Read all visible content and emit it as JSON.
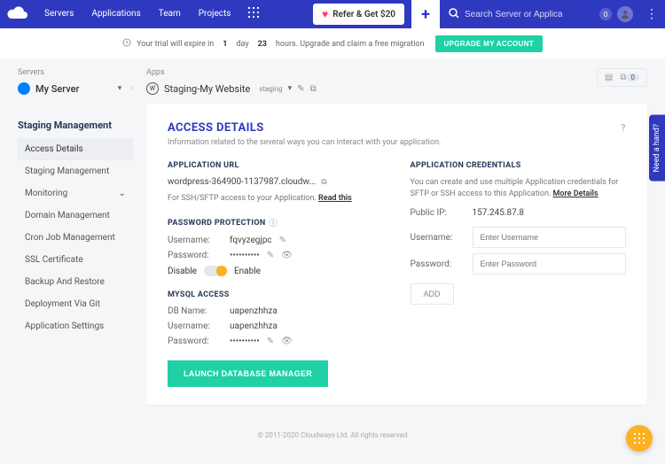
{
  "nav": {
    "servers": "Servers",
    "applications": "Applications",
    "team": "Team",
    "projects": "Projects"
  },
  "top": {
    "refer": "Refer & Get $20",
    "search_placeholder": "Search Server or Application",
    "notif_count": "0"
  },
  "trial": {
    "prefix": "Your trial will expire in",
    "days": "1",
    "days_label": "day",
    "hours": "23",
    "hours_label": "hours. Upgrade and claim a free migration",
    "upgrade": "UPGRADE MY ACCOUNT"
  },
  "breadcrumb": {
    "servers_label": "Servers",
    "server_name": "My Server",
    "apps_label": "Apps",
    "app_name": "Staging-My Website",
    "app_tag": "staging"
  },
  "app_status_count": "0",
  "side": {
    "heading": "Staging Management",
    "items": [
      "Access Details",
      "Staging Management",
      "Monitoring",
      "Domain Management",
      "Cron Job Management",
      "SSL Certificate",
      "Backup And Restore",
      "Deployment Via Git",
      "Application Settings"
    ]
  },
  "card": {
    "title": "ACCESS DETAILS",
    "subtitle": "Information related to the several ways you can interact with your application."
  },
  "left": {
    "app_url_head": "APPLICATION URL",
    "app_url": "wordpress-364900-1137987.cloudw...",
    "app_url_hint_pre": "For SSH/SFTP access to your Application. ",
    "app_url_hint_link": "Read this",
    "pwd_head": "PASSWORD PROTECTION",
    "user_label": "Username:",
    "user_val": "fqvyzegjpc",
    "pass_label": "Password:",
    "pass_val": "••••••••••",
    "disable": "Disable",
    "enable": "Enable",
    "mysql_head": "MYSQL ACCESS",
    "db_label": "DB Name:",
    "db_val": "uapenzhhza",
    "mysql_user_val": "uapenzhhza",
    "mysql_pass_val": "••••••••••",
    "launch": "LAUNCH DATABASE MANAGER"
  },
  "right": {
    "cred_head": "APPLICATION CREDENTIALS",
    "cred_desc_pre": "You can create and use multiple Application credentials for SFTP or SSH access to this Application. ",
    "cred_desc_link": "More Details",
    "ip_label": "Public IP:",
    "ip_val": "157.245.87.8",
    "user_label": "Username:",
    "user_placeholder": "Enter Username",
    "pass_label": "Password:",
    "pass_placeholder": "Enter Password",
    "add": "ADD"
  },
  "footer": "© 2011-2020 Cloudways Ltd. All rights reserved",
  "helper": "Need a hand?"
}
